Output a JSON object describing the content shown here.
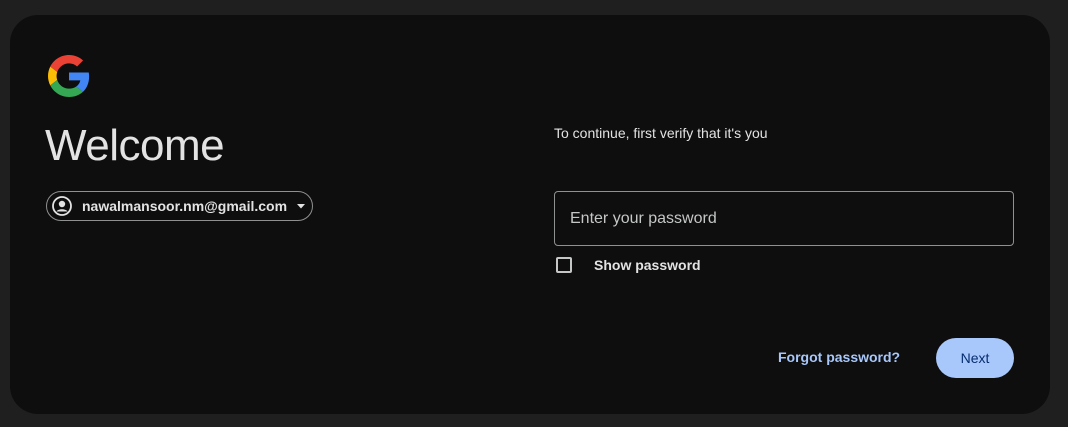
{
  "app": {
    "logo_icon": "google-g-logo-icon"
  },
  "header": {
    "title": "Welcome"
  },
  "account": {
    "email": "nawalmansoor.nm@gmail.com",
    "avatar_icon": "account-circle-icon",
    "dropdown_icon": "caret-down-icon"
  },
  "form": {
    "subtitle": "To continue, first verify that it's you",
    "password_placeholder": "Enter your password",
    "password_value": "",
    "show_password_label": "Show password",
    "show_password_checked": false
  },
  "actions": {
    "forgot_label": "Forgot password?",
    "next_label": "Next"
  },
  "colors": {
    "page_background": "#1f1f1f",
    "card_background": "#0e0e0e",
    "primary_accent": "#a8c7fa",
    "primary_on_accent": "#062e6f",
    "text": "#e3e3e3",
    "outline": "#8e918f",
    "google_blue": "#4285F4",
    "google_red": "#EA4335",
    "google_yellow": "#FBBC05",
    "google_green": "#34A853"
  }
}
